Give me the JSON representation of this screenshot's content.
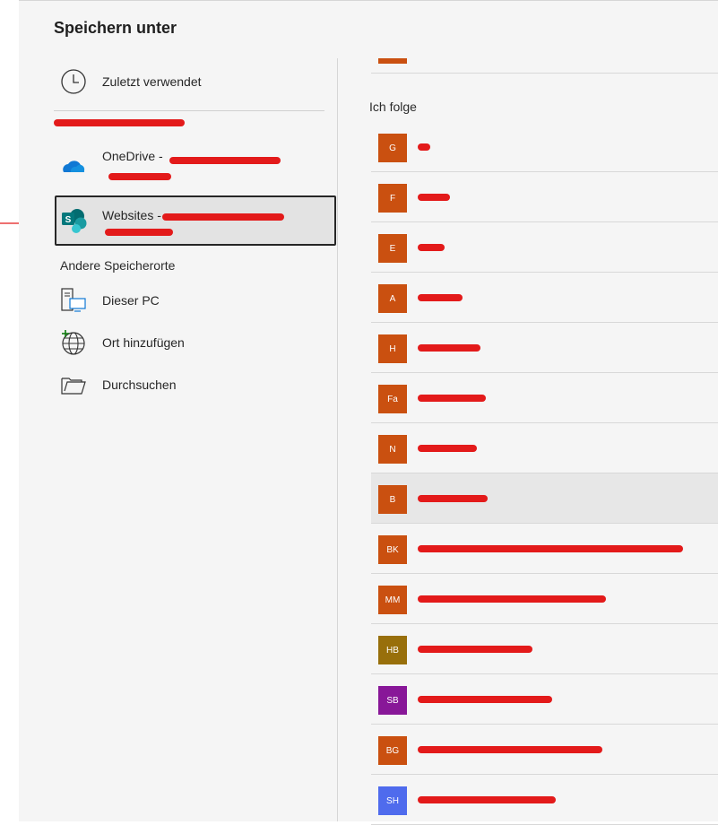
{
  "dialog": {
    "title": "Speichern unter"
  },
  "nav": {
    "recent_label": "Zuletzt verwendet",
    "other_locations_label": "Andere Speicherorte",
    "this_pc_label": "Dieser PC",
    "add_place_label": "Ort hinzufügen",
    "browse_label": "Durchsuchen"
  },
  "accounts": {
    "onedrive_label": "OneDrive -",
    "websites_label": "Websites -"
  },
  "right": {
    "header": "Ich folge"
  },
  "sites": [
    {
      "initials": "G",
      "name": "",
      "color": "#ca5010"
    },
    {
      "initials": "F",
      "name": "",
      "color": "#ca5010"
    },
    {
      "initials": "E",
      "name": "",
      "color": "#ca5010"
    },
    {
      "initials": "A",
      "name": "",
      "color": "#ca5010"
    },
    {
      "initials": "H",
      "name": "",
      "color": "#ca5010"
    },
    {
      "initials": "Fa",
      "name": "",
      "color": "#ca5010"
    },
    {
      "initials": "N",
      "name": "",
      "color": "#ca5010"
    },
    {
      "initials": "B",
      "name": "",
      "color": "#ca5010"
    },
    {
      "initials": "BK",
      "name": "",
      "color": "#ca5010"
    },
    {
      "initials": "MM",
      "name": "",
      "color": "#ca5010"
    },
    {
      "initials": "HB",
      "name": "",
      "color": "#986f0b"
    },
    {
      "initials": "SB",
      "name": "",
      "color": "#881798"
    },
    {
      "initials": "BG",
      "name": "",
      "color": "#ca5010"
    },
    {
      "initials": "SH",
      "name": "",
      "color": "#4f6bed"
    }
  ],
  "colors": {
    "accent": "#ca5010",
    "redaction": "#e31a1a"
  }
}
